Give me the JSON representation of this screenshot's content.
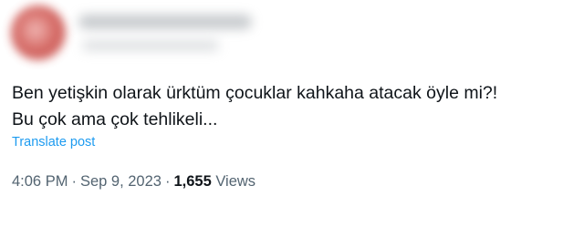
{
  "tweet": {
    "line1": "Ben yetişkin olarak ürktüm çocuklar kahkaha atacak öyle mi?!",
    "line2": "Bu çok ama çok tehlikeli...",
    "translate_label": "Translate post"
  },
  "meta": {
    "time": "4:06 PM",
    "date": "Sep 9, 2023",
    "separator": "·",
    "views_count": "1,655",
    "views_label": "Views"
  },
  "colors": {
    "link": "#1d9bf0",
    "text": "#0f1419",
    "muted": "#536471",
    "avatar": "#c94c47"
  }
}
